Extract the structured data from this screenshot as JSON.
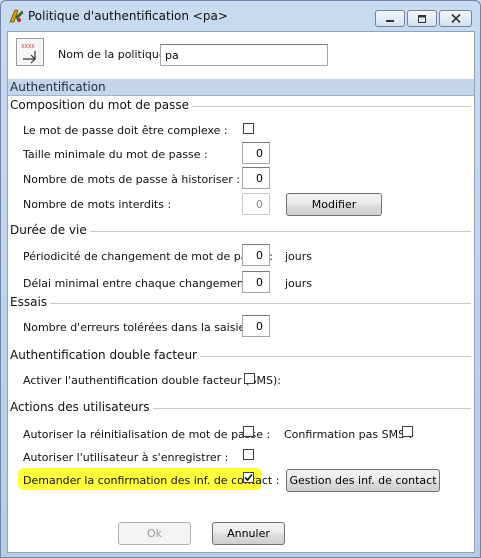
{
  "window": {
    "title": "Politique d'authentification <pa>"
  },
  "header": {
    "policy_name_label": "Nom de la politique :",
    "policy_name_value": "pa",
    "tab_label": "Authentification"
  },
  "password_composition": {
    "section_title": "Composition du mot de passe",
    "complex_label": "Le mot de passe doit être complexe :",
    "complex_checked": false,
    "min_length_label": "Taille minimale du mot de passe :",
    "min_length_value": "0",
    "history_label": "Nombre de mots de passe à historiser :",
    "history_value": "0",
    "forbidden_label": "Nombre de mots interdits :",
    "forbidden_value": "0",
    "modify_button": "Modifier"
  },
  "lifetime": {
    "section_title": "Durée de vie",
    "change_period_label": "Périodicité de changement de mot de passe :",
    "change_period_value": "0",
    "change_period_unit": "jours",
    "min_delay_label": "Délai minimal entre chaque changement :",
    "min_delay_value": "0",
    "min_delay_unit": "jours"
  },
  "attempts": {
    "section_title": "Essais",
    "errors_label": "Nombre d'erreurs tolérées dans la saisie :",
    "errors_value": "0"
  },
  "two_factor": {
    "section_title": "Authentification double facteur",
    "enable_label": "Activer l'authentification double facteur (SMS):",
    "enable_checked": false
  },
  "user_actions": {
    "section_title": "Actions des utilisateurs",
    "allow_reset_label": "Autoriser la réinitialisation de mot de passe :",
    "allow_reset_checked": false,
    "sms_confirm_label": "Confirmation pas SMS :",
    "sms_confirm_checked": false,
    "allow_register_label": "Autoriser l'utilisateur à s'enregistrer :",
    "allow_register_checked": false,
    "request_confirm_label": "Demander la confirmation des inf. de contact :",
    "request_confirm_checked": true,
    "contact_button": "Gestion des inf. de contact",
    "highlight_color": "#ffff3c"
  },
  "footer": {
    "ok_button": "Ok",
    "cancel_button": "Annuler"
  }
}
